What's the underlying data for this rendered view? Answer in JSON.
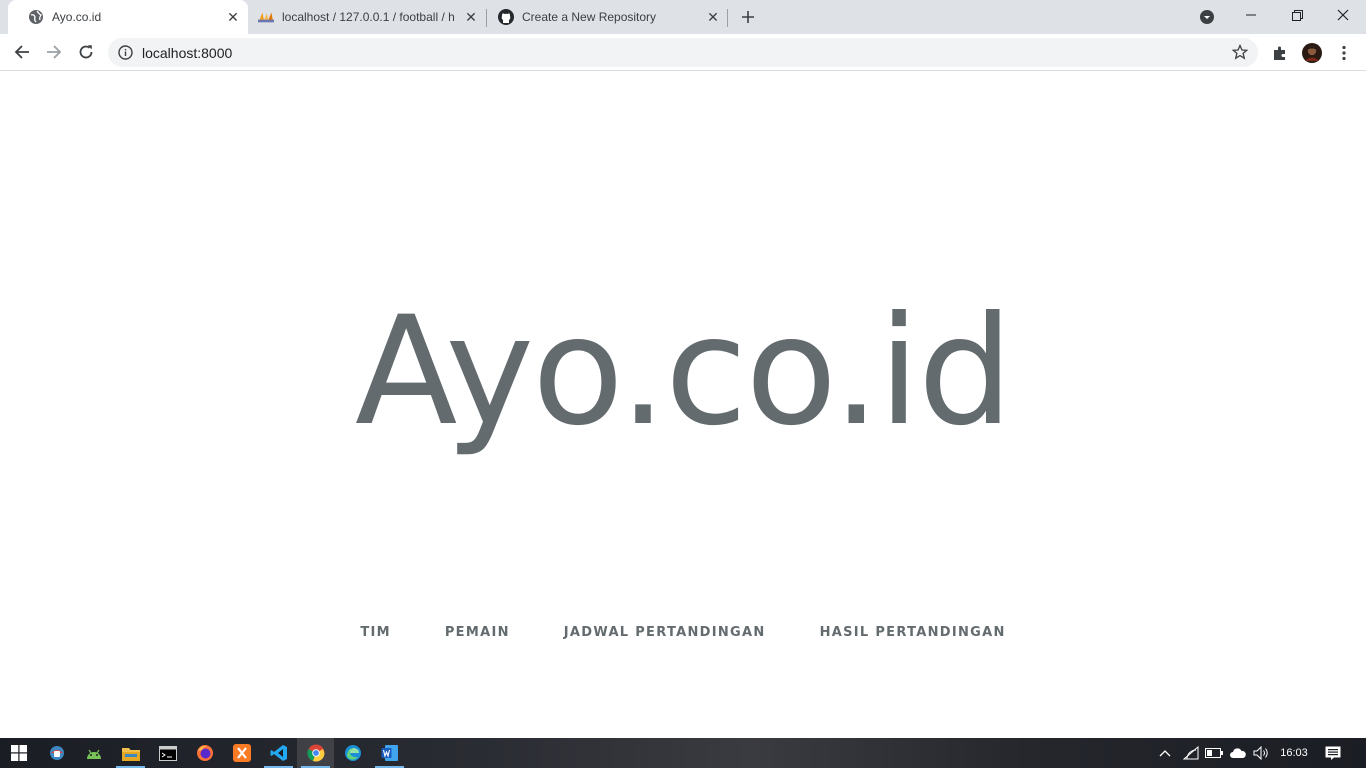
{
  "browser": {
    "tabs": [
      {
        "title": "Ayo.co.id",
        "active": true,
        "icon": "globe-icon"
      },
      {
        "title": "localhost / 127.0.0.1 / football / h",
        "active": false,
        "icon": "phpmyadmin-icon"
      },
      {
        "title": "Create a New Repository",
        "active": false,
        "icon": "github-icon"
      }
    ],
    "url": "localhost:8000"
  },
  "page": {
    "brand": "Ayo.co.id",
    "nav": [
      "TIM",
      "PEMAIN",
      "JADWAL PERTANDINGAN",
      "HASIL PERTANDINGAN"
    ]
  },
  "taskbar": {
    "clock": "16:03"
  },
  "colors": {
    "brand_text": "#636b6f",
    "tabstrip_bg": "#dee1e6",
    "taskbar_bg": "#1b1d24",
    "taskbar_accent": "#76b9ed"
  }
}
